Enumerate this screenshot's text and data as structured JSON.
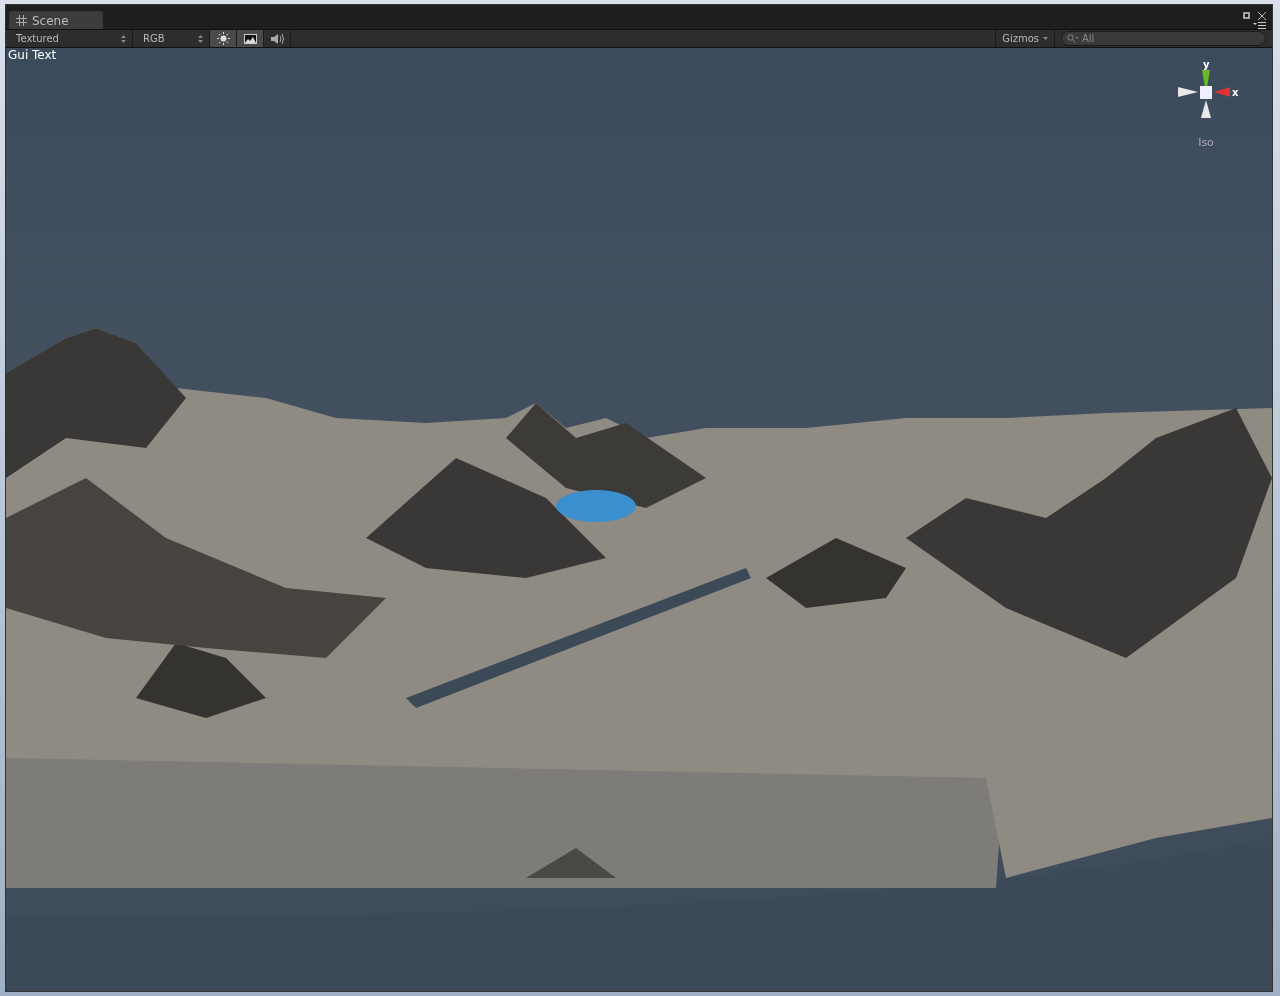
{
  "window": {
    "tab": {
      "label": "Scene",
      "selected": true
    }
  },
  "toolbar": {
    "render_mode": "Textured",
    "channel": "RGB",
    "toggles": [
      {
        "kind": "lighting",
        "on": true
      },
      {
        "kind": "image",
        "on": true
      },
      {
        "kind": "audio",
        "on": false
      }
    ],
    "gizmos": "Gizmos",
    "search": {
      "placeholder": "All"
    }
  },
  "viewport": {
    "overlay_text": "Gui Text",
    "gizmo": {
      "y_label": "y",
      "x_label": "x",
      "projection": "Iso"
    }
  }
}
